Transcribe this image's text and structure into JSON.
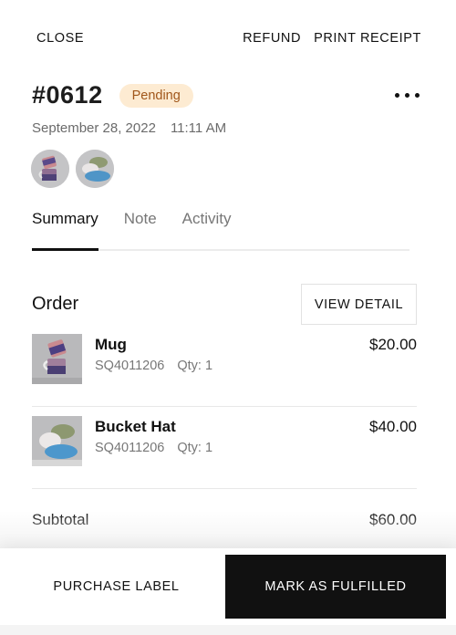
{
  "topbar": {
    "close_label": "CLOSE",
    "refund_label": "REFUND",
    "print_label": "PRINT RECEIPT"
  },
  "order": {
    "number": "#0612",
    "status": "Pending",
    "status_colors": {
      "background": "#fdebd2",
      "text": "#a0561a"
    },
    "date": "September 28, 2022",
    "time": "11:11 AM",
    "more_icon": "more-horizontal-icon"
  },
  "avatars": [
    {
      "name": "mug-thumbnail"
    },
    {
      "name": "bucket-hat-thumbnail"
    }
  ],
  "tabs": [
    {
      "label": "Summary",
      "active": true
    },
    {
      "label": "Note",
      "active": false
    },
    {
      "label": "Activity",
      "active": false
    }
  ],
  "order_section": {
    "title": "Order",
    "view_detail_label": "VIEW DETAIL",
    "items": [
      {
        "name": "Mug",
        "sku": "SQ4011206",
        "qty": "Qty: 1",
        "price": "$20.00"
      },
      {
        "name": "Bucket Hat",
        "sku": "SQ4011206",
        "qty": "Qty: 1",
        "price": "$40.00"
      }
    ],
    "subtotal_label": "Subtotal",
    "subtotal_value": "$60.00"
  },
  "actions": {
    "purchase_label": "PURCHASE LABEL",
    "fulfill_label": "MARK AS FULFILLED",
    "primary_color": "#111111"
  }
}
